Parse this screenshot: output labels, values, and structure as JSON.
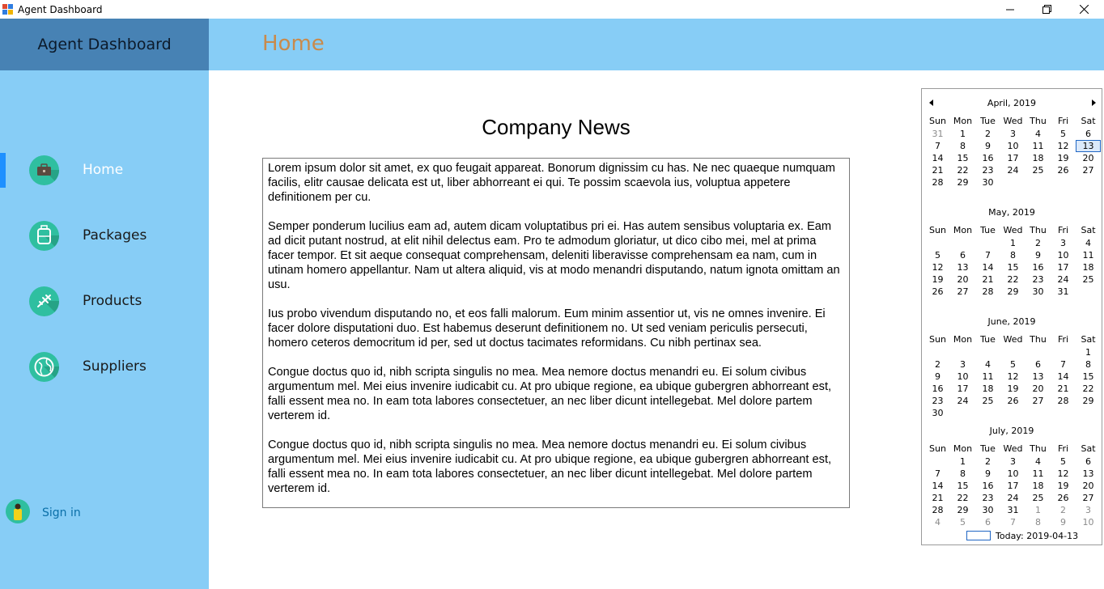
{
  "window": {
    "title": "Agent Dashboard"
  },
  "sidebar": {
    "brand": "Agent Dashboard",
    "items": [
      {
        "label": "Home",
        "icon": "briefcase-icon",
        "active": true
      },
      {
        "label": "Packages",
        "icon": "luggage-icon",
        "active": false
      },
      {
        "label": "Products",
        "icon": "airplane-icon",
        "active": false
      },
      {
        "label": "Suppliers",
        "icon": "globe-icon",
        "active": false
      }
    ],
    "signin": "Sign in"
  },
  "header": {
    "page_title": "Home"
  },
  "news": {
    "heading": "Company News",
    "paragraphs": [
      "Lorem ipsum dolor sit amet, ex quo feugait appareat. Bonorum dignissim cu has. Ne nec quaeque numquam facilis, elitr causae delicata est ut, liber abhorreant ei qui. Te possim scaevola ius, voluptua appetere definitionem per cu.",
      "Semper ponderum lucilius eam ad, autem dicam voluptatibus pri ei. Has autem sensibus voluptaria ex. Eam ad dicit putant nostrud, at elit nihil delectus eam. Pro te admodum gloriatur, ut dico cibo mei, mel at prima facer tempor. Et sit aeque consequat comprehensam, deleniti liberavisse comprehensam ea nam, cum in utinam homero appellantur. Nam ut altera aliquid, vis at modo menandri disputando, natum ignota omittam an usu.",
      "Ius probo vivendum disputando no, et eos falli malorum. Eum minim assentior ut, vis ne omnes invenire. Ei facer dolore disputationi duo. Est habemus deserunt definitionem no. Ut sed veniam periculis persecuti, homero ceteros democritum id per, sed ut doctus tacimates reformidans. Cu nibh pertinax sea.",
      "Congue doctus quo id, nibh scripta singulis no mea. Mea nemore doctus menandri eu. Ei solum civibus argumentum mel. Mei eius invenire iudicabit cu. At pro ubique regione, ea ubique gubergren abhorreant est, falli essent mea no. In eam tota labores consectetuer, an nec liber dicunt intellegebat. Mel dolore partem verterem id.",
      "Congue doctus quo id, nibh scripta singulis no mea. Mea nemore doctus menandri eu. Ei solum civibus argumentum mel. Mei eius invenire iudicabit cu. At pro ubique regione, ea ubique gubergren abhorreant est, falli essent mea no. In eam tota labores consectetuer, an nec liber dicunt intellegebat. Mel dolore partem verterem id."
    ]
  },
  "calendar": {
    "weekdays": [
      "Sun",
      "Mon",
      "Tue",
      "Wed",
      "Thu",
      "Fri",
      "Sat"
    ],
    "months": [
      {
        "title": "April, 2019",
        "cells": [
          "31",
          "1",
          "2",
          "3",
          "4",
          "5",
          "6",
          "7",
          "8",
          "9",
          "10",
          "11",
          "12",
          "13",
          "14",
          "15",
          "16",
          "17",
          "18",
          "19",
          "20",
          "21",
          "22",
          "23",
          "24",
          "25",
          "26",
          "27",
          "28",
          "29",
          "30",
          "",
          "",
          "",
          "",
          ""
        ],
        "dim": [
          0
        ],
        "selected": 13
      },
      {
        "title": "May, 2019",
        "cells": [
          "",
          "",
          "",
          "1",
          "2",
          "3",
          "4",
          "5",
          "6",
          "7",
          "8",
          "9",
          "10",
          "11",
          "12",
          "13",
          "14",
          "15",
          "16",
          "17",
          "18",
          "19",
          "20",
          "21",
          "22",
          "23",
          "24",
          "25",
          "26",
          "27",
          "28",
          "29",
          "30",
          "31",
          "",
          ""
        ],
        "dim": [],
        "selected": -1
      },
      {
        "title": "June, 2019",
        "cells": [
          "",
          "",
          "",
          "",
          "",
          "",
          "1",
          "2",
          "3",
          "4",
          "5",
          "6",
          "7",
          "8",
          "9",
          "10",
          "11",
          "12",
          "13",
          "14",
          "15",
          "16",
          "17",
          "18",
          "19",
          "20",
          "21",
          "22",
          "23",
          "24",
          "25",
          "26",
          "27",
          "28",
          "29",
          "30",
          "",
          "",
          "",
          "",
          "",
          ""
        ],
        "dim": [],
        "selected": -1
      },
      {
        "title": "July, 2019",
        "cells": [
          "",
          "1",
          "2",
          "3",
          "4",
          "5",
          "6",
          "7",
          "8",
          "9",
          "10",
          "11",
          "12",
          "13",
          "14",
          "15",
          "16",
          "17",
          "18",
          "19",
          "20",
          "21",
          "22",
          "23",
          "24",
          "25",
          "26",
          "27",
          "28",
          "29",
          "30",
          "31",
          "1",
          "2",
          "3",
          "4",
          "5",
          "6",
          "7",
          "8",
          "9",
          "10"
        ],
        "dim": [
          32,
          33,
          34,
          35,
          36,
          37,
          38,
          39,
          40,
          41
        ],
        "selected": -1
      }
    ],
    "today": "Today: 2019-04-13"
  },
  "colors": {
    "sidebar": "#87cdf6",
    "brand": "#4782b4",
    "accent_title": "#c98a4b",
    "active_marker": "#1e90ff",
    "icon_circle": "#2fbfa0"
  }
}
